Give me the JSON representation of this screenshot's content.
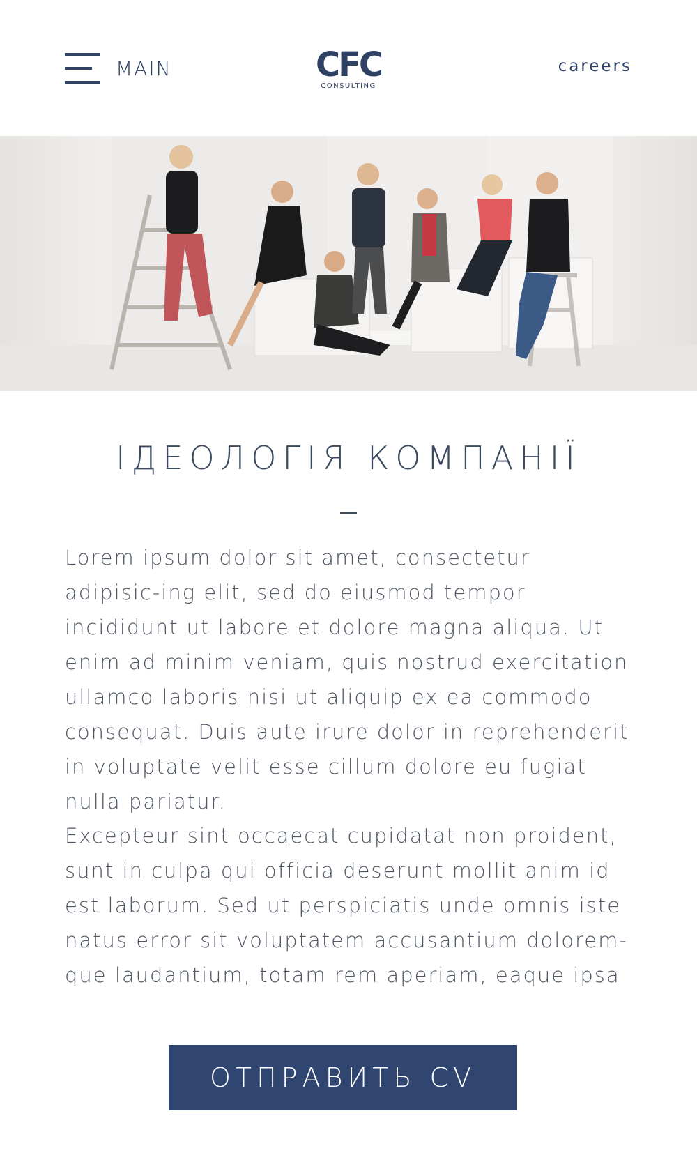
{
  "header": {
    "menu_label": "MAIN",
    "logo_mark": "CFC",
    "logo_sub": "CONSULTING",
    "careers_label": "careers"
  },
  "icons": {
    "menu": "hamburger-icon",
    "logo": "cfc-logo"
  },
  "colors": {
    "brand": "#304570",
    "text": "#505864"
  },
  "main": {
    "title": "ІДЕОЛОГІЯ КОМПАНІЇ",
    "paragraph_1": "Lorem ipsum dolor sit amet, consectetur adipisic-ing elit, sed do eiusmod tempor incididunt ut labore et dolore magna aliqua. Ut enim ad minim veniam, quis nostrud exercitation ullamco laboris nisi ut aliquip ex ea commodo consequat. Duis aute irure dolor in reprehenderit in voluptate velit esse cillum dolore eu fugiat nulla pariatur.",
    "paragraph_2": "Excepteur sint occaecat cupidatat non proident, sunt in culpa qui officia deserunt mollit anim id est laborum. Sed ut perspiciatis unde omnis iste natus error sit voluptatem accusantium dolorem-que laudantium, totam rem aperiam, eaque ipsa",
    "button_label": "ОТПРАВИТЬ CV"
  }
}
